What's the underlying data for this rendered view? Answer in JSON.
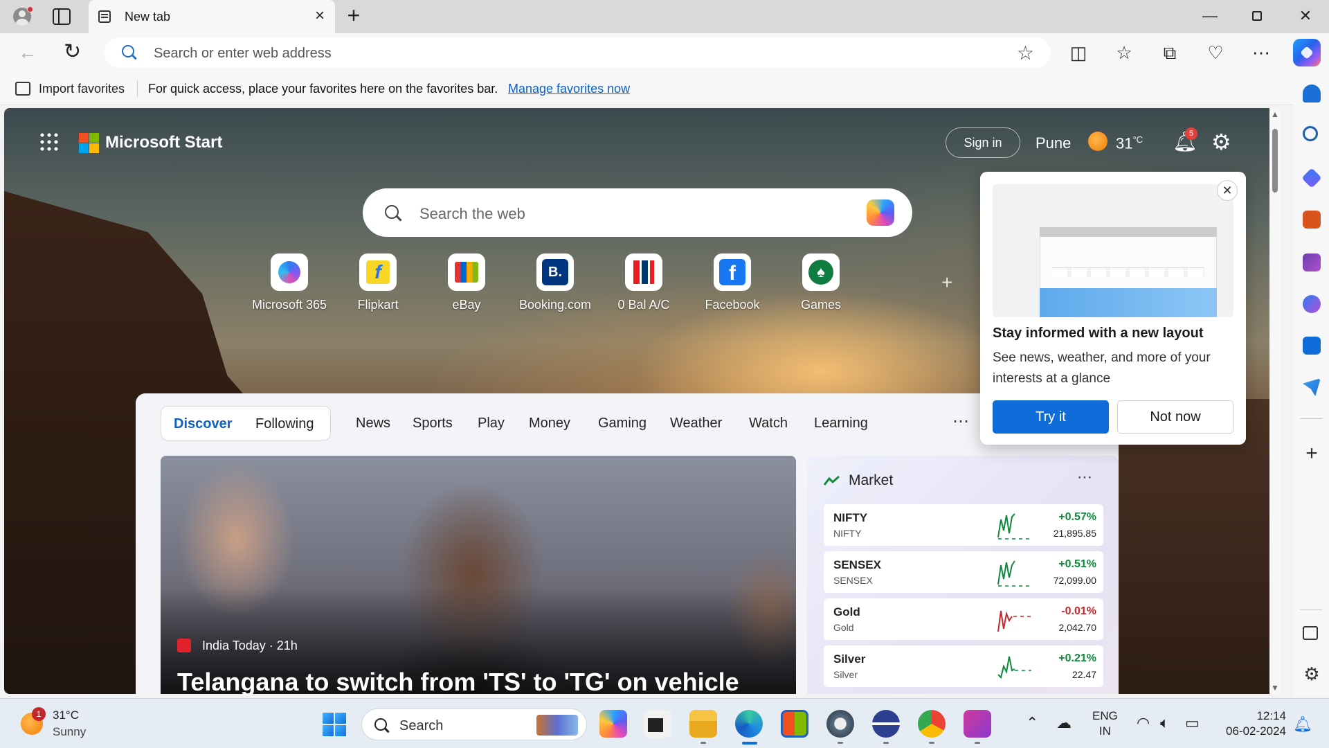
{
  "browser": {
    "tab_title": "New tab",
    "address_placeholder": "Search or enter web address",
    "favorites_bar": {
      "import_label": "Import favorites",
      "message": "For quick access, place your favorites here on the favorites bar.",
      "link": "Manage favorites now"
    }
  },
  "page": {
    "brand": "Microsoft Start",
    "sign_in": "Sign in",
    "weather": {
      "city": "Pune",
      "temp": "31",
      "unit": "°C"
    },
    "notification_count": "5",
    "search_placeholder": "Search the web",
    "quick_links": [
      {
        "label": "Microsoft 365",
        "icon": "microsoft-365-icon"
      },
      {
        "label": "Flipkart",
        "icon": "flipkart-icon"
      },
      {
        "label": "eBay",
        "icon": "ebay-icon"
      },
      {
        "label": "Booking.com",
        "icon": "booking-icon",
        "glyph": "B."
      },
      {
        "label": "0 Bal A/C",
        "icon": "kotak-icon"
      },
      {
        "label": "Facebook",
        "icon": "facebook-icon",
        "glyph": "f"
      },
      {
        "label": "Games",
        "icon": "games-icon"
      }
    ],
    "feed_tabs": {
      "discover": "Discover",
      "following": "Following",
      "links": [
        "News",
        "Sports",
        "Play",
        "Money",
        "Gaming",
        "Weather",
        "Watch",
        "Learning"
      ]
    },
    "hero": {
      "source": "India Today · 21h",
      "headline": "Telangana to switch from 'TS' to 'TG' on vehicle"
    },
    "market": {
      "title": "Market",
      "quotes": [
        {
          "symbol": "NIFTY",
          "name": "NIFTY",
          "change": "+0.57%",
          "price": "21,895.85",
          "direction": "up"
        },
        {
          "symbol": "SENSEX",
          "name": "SENSEX",
          "change": "+0.51%",
          "price": "72,099.00",
          "direction": "up"
        },
        {
          "symbol": "Gold",
          "name": "Gold",
          "change": "-0.01%",
          "price": "2,042.70",
          "direction": "down"
        },
        {
          "symbol": "Silver",
          "name": "Silver",
          "change": "+0.21%",
          "price": "22.47",
          "direction": "up"
        }
      ]
    },
    "popup": {
      "title": "Stay informed with a new layout",
      "description": "See news, weather, and more of your interests at a glance",
      "primary": "Try it",
      "secondary": "Not now"
    }
  },
  "taskbar": {
    "weather_badge": "1",
    "temp": "31°C",
    "condition": "Sunny",
    "search_placeholder": "Search",
    "lang_top": "ENG",
    "lang_bottom": "IN",
    "time": "12:14",
    "date": "06-02-2024"
  },
  "colors": {
    "accent": "#0f6cd8",
    "up": "#0f8a3c",
    "down": "#c4262d"
  }
}
